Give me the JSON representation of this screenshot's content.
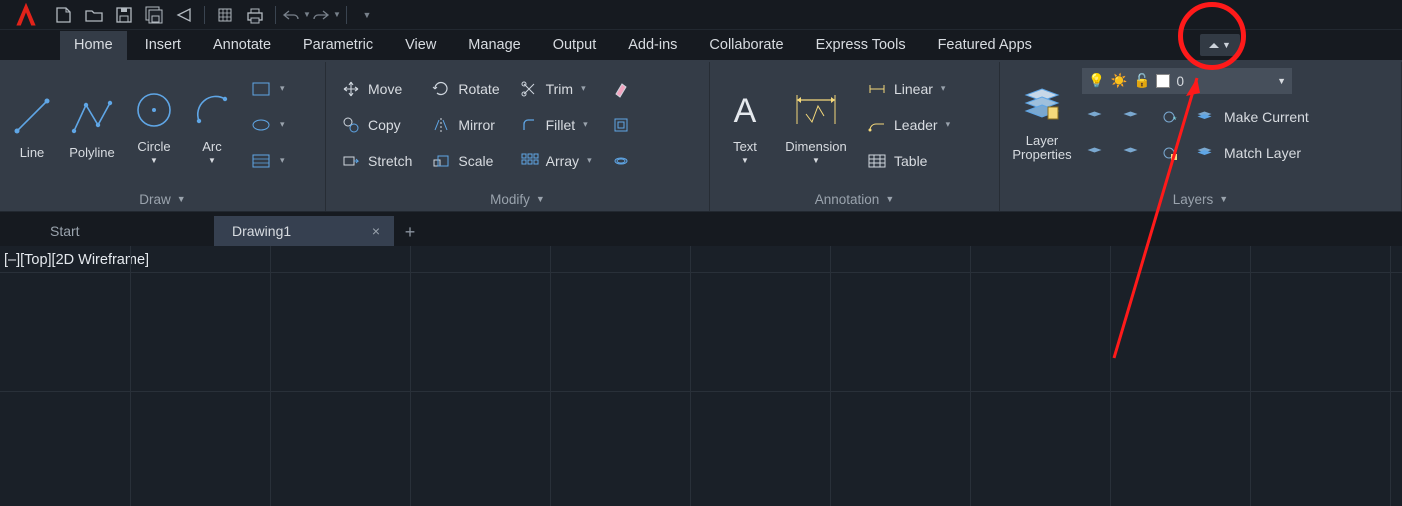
{
  "qat": {
    "tooltips": [
      "new",
      "open",
      "save",
      "saveall",
      "share",
      "cloud",
      "print",
      "undo",
      "redo"
    ]
  },
  "tabs": {
    "items": [
      {
        "label": "Home",
        "active": true
      },
      {
        "label": "Insert"
      },
      {
        "label": "Annotate"
      },
      {
        "label": "Parametric"
      },
      {
        "label": "View"
      },
      {
        "label": "Manage"
      },
      {
        "label": "Output"
      },
      {
        "label": "Add-ins"
      },
      {
        "label": "Collaborate"
      },
      {
        "label": "Express Tools"
      },
      {
        "label": "Featured Apps"
      }
    ]
  },
  "ribbon": {
    "panels": {
      "draw": {
        "title": "Draw",
        "tools": [
          {
            "label": "Line"
          },
          {
            "label": "Polyline"
          },
          {
            "label": "Circle"
          },
          {
            "label": "Arc"
          }
        ]
      },
      "modify": {
        "title": "Modify",
        "row1": [
          {
            "label": "Move"
          },
          {
            "label": "Rotate"
          },
          {
            "label": "Trim"
          }
        ],
        "row2": [
          {
            "label": "Copy"
          },
          {
            "label": "Mirror"
          },
          {
            "label": "Fillet"
          }
        ],
        "row3": [
          {
            "label": "Stretch"
          },
          {
            "label": "Scale"
          },
          {
            "label": "Array"
          }
        ]
      },
      "annotation": {
        "title": "Annotation",
        "text": "Text",
        "dimension": "Dimension",
        "side": [
          {
            "label": "Linear"
          },
          {
            "label": "Leader"
          },
          {
            "label": "Table"
          }
        ]
      },
      "layers": {
        "title": "Layers",
        "properties": "Layer\nProperties",
        "current_layer": "0",
        "actions": [
          {
            "label": "Make Current"
          },
          {
            "label": "Match Layer"
          }
        ]
      }
    }
  },
  "doctabs": [
    {
      "label": "Start"
    },
    {
      "label": "Drawing1",
      "active": true
    }
  ],
  "viewport_label": "[–][Top][2D Wireframe]",
  "colors": {
    "accent": "#5fa6e6",
    "highlight": "#ff1a1a"
  }
}
